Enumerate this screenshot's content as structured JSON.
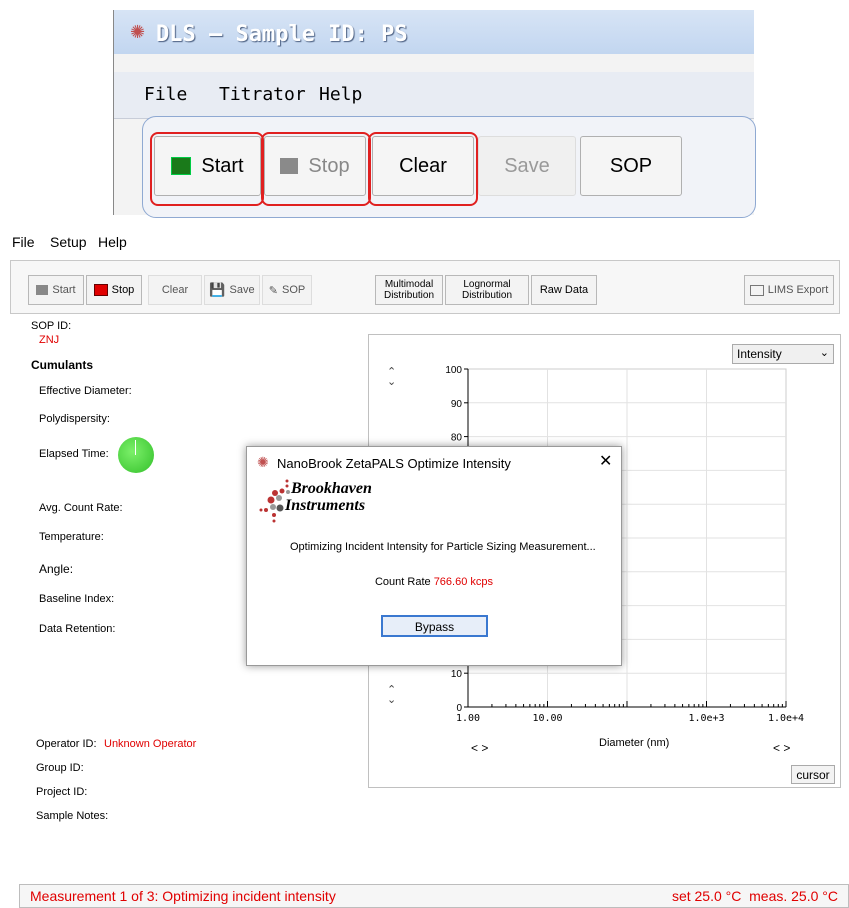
{
  "old_window": {
    "title": "DLS – Sample ID: PS",
    "menu": [
      "File",
      "Titrator",
      "Help"
    ],
    "buttons": {
      "start": "Start",
      "stop": "Stop",
      "clear": "Clear",
      "save": "Save",
      "sop": "SOP"
    }
  },
  "menu": [
    "File",
    "Setup",
    "Help"
  ],
  "toolbar": {
    "start": "Start",
    "stop": "Stop",
    "clear": "Clear",
    "save": "Save",
    "sop": "SOP",
    "multimodal": [
      "Multimodal",
      "Distribution"
    ],
    "lognormal": [
      "Lognormal",
      "Distribution"
    ],
    "raw_data": "Raw Data",
    "lims_export": "LIMS Export"
  },
  "left_panel": {
    "sop_id_label": "SOP ID:",
    "sop_id_value": "ZNJ",
    "cumulants": "Cumulants",
    "effective_diameter": "Effective Diameter:",
    "polydispersity": "Polydispersity:",
    "elapsed_time": "Elapsed Time:",
    "avg_count_rate": "Avg. Count Rate:",
    "temperature": "Temperature:",
    "angle": "Angle:",
    "baseline_index": "Baseline Index:",
    "data_retention": "Data Retention:",
    "operator_id_label": "Operator ID:",
    "operator_id_value": "Unknown Operator",
    "group_id": "Group ID:",
    "project_id": "Project ID:",
    "sample_notes": "Sample Notes:"
  },
  "chart": {
    "mode_select": "Intensity",
    "cursor_button": "cursor",
    "xlabel": "Diameter (nm)",
    "x_ticks": [
      "1.00",
      "10.00",
      "1.0e+3",
      "1.0e+4"
    ],
    "y_ticks": [
      "100",
      "90",
      "80",
      "10",
      "0"
    ]
  },
  "chart_data": {
    "type": "bar",
    "xlabel": "Diameter (nm)",
    "ylabel": "",
    "x_scale": "log",
    "xlim": [
      1,
      10000
    ],
    "ylim": [
      0,
      100
    ],
    "x_tick_labels": [
      "1.00",
      "10.00",
      "1.0e+3",
      "1.0e+4"
    ],
    "y_tick_labels": [
      "0",
      "10",
      "80",
      "90",
      "100"
    ],
    "grid": true,
    "series": []
  },
  "dialog": {
    "title": "NanoBrook ZetaPALS Optimize Intensity",
    "logo_line1": "Brookhaven",
    "logo_line2": "Instruments",
    "message": "Optimizing Incident Intensity for Particle Sizing Measurement...",
    "count_rate_label": "Count Rate",
    "count_rate_value": "766.60 kcps",
    "bypass": "Bypass"
  },
  "status": {
    "left": "Measurement 1 of 3: Optimizing incident intensity",
    "right": "set 25.0 °C  meas. 25.0 °C"
  }
}
